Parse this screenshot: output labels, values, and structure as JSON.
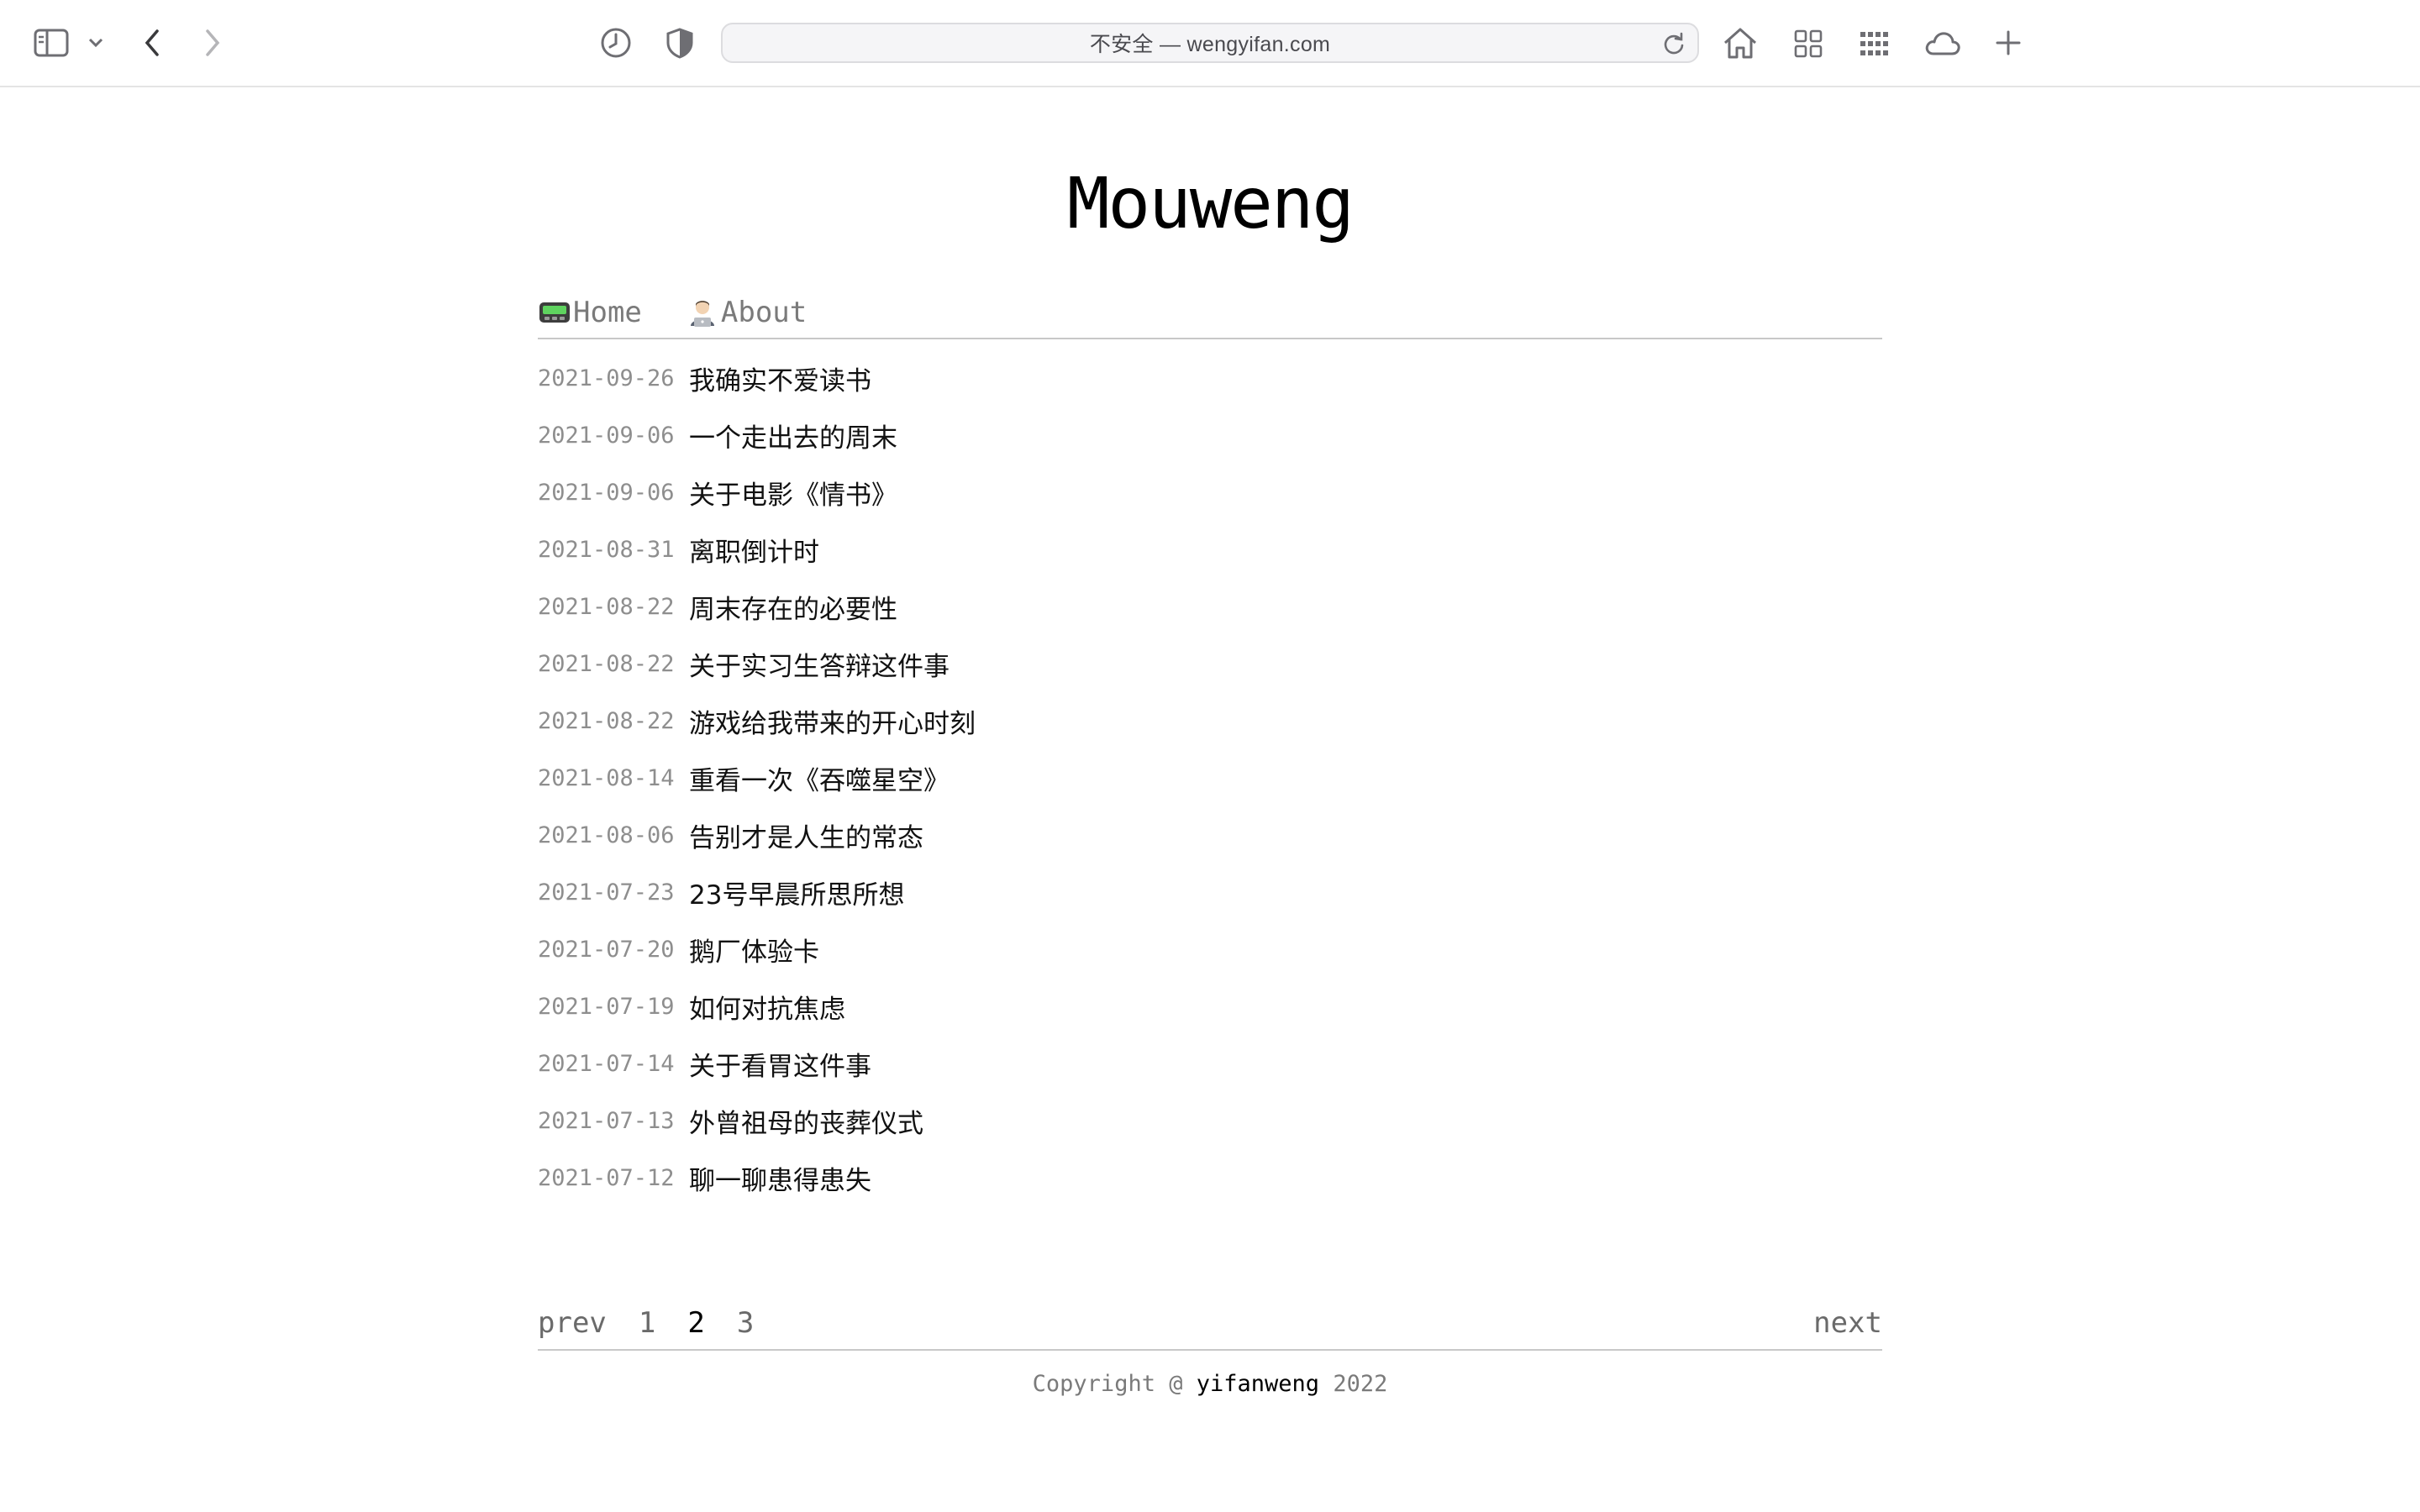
{
  "browser": {
    "address": "不安全 — wengyifan.com",
    "icons": {
      "sidebar": "sidebar-icon",
      "sidebar_menu": "chevron-down-icon",
      "back": "chevron-left-icon",
      "forward": "chevron-right-icon",
      "history": "clock-icon",
      "privacy": "half-shield-icon",
      "reload": "reload-icon",
      "home": "home-icon",
      "tab_overview": "grid-icon",
      "apps": "dots-grid-icon",
      "cloud": "cloud-icon",
      "new_tab": "plus-icon"
    }
  },
  "site": {
    "title": "Mouweng",
    "nav": [
      {
        "label": "Home",
        "icon": "pager-icon"
      },
      {
        "label": "About",
        "icon": "technologist-icon"
      }
    ]
  },
  "posts": [
    {
      "date": "2021-09-26",
      "title": "我确实不爱读书"
    },
    {
      "date": "2021-09-06",
      "title": "一个走出去的周末"
    },
    {
      "date": "2021-09-06",
      "title": "关于电影《情书》"
    },
    {
      "date": "2021-08-31",
      "title": "离职倒计时"
    },
    {
      "date": "2021-08-22",
      "title": "周末存在的必要性"
    },
    {
      "date": "2021-08-22",
      "title": "关于实习生答辩这件事"
    },
    {
      "date": "2021-08-22",
      "title": "游戏给我带来的开心时刻"
    },
    {
      "date": "2021-08-14",
      "title": "重看一次《吞噬星空》"
    },
    {
      "date": "2021-08-06",
      "title": "告别才是人生的常态"
    },
    {
      "date": "2021-07-23",
      "title": "23号早晨所思所想"
    },
    {
      "date": "2021-07-20",
      "title": "鹅厂体验卡"
    },
    {
      "date": "2021-07-19",
      "title": "如何对抗焦虑"
    },
    {
      "date": "2021-07-14",
      "title": "关于看胃这件事"
    },
    {
      "date": "2021-07-13",
      "title": "外曾祖母的丧葬仪式"
    },
    {
      "date": "2021-07-12",
      "title": "聊一聊患得患失"
    }
  ],
  "pagination": {
    "prev": "prev",
    "pages": [
      "1",
      "2",
      "3"
    ],
    "current": "2",
    "next": "next"
  },
  "footer": {
    "prefix": "Copyright @",
    "author": "yifanweng",
    "year": "2022"
  }
}
